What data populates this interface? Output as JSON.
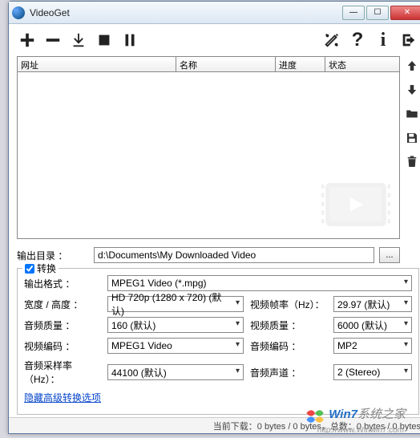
{
  "window": {
    "title": "VideoGet"
  },
  "winbtns": {
    "min": "—",
    "max": "☐",
    "close": "✕"
  },
  "grid": {
    "cols": {
      "url": "网址",
      "name": "名称",
      "progress": "进度",
      "status": "状态"
    }
  },
  "outdir": {
    "label": "输出目录 ：",
    "value": "d:\\Documents\\My Downloaded Video",
    "browse": "..."
  },
  "convert": {
    "legend": "转换",
    "format_label": "输出格式 ：",
    "format_value": "MPEG1 Video (*.mpg)",
    "size_label": "宽度 / 高度 ：",
    "size_value": "HD 720p (1280 x 720) (默认)",
    "fps_label": "视频帧率（Hz）：",
    "fps_value": "29.97 (默认)",
    "aq_label": "音频质量 ：",
    "aq_value": "160 (默认)",
    "vq_label": "视频质量 ：",
    "vq_value": "6000 (默认)",
    "vc_label": "视频编码 ：",
    "vc_value": "MPEG1 Video",
    "ac_label": "音频编码 ：",
    "ac_value": "MP2",
    "ar_label": "音频采样率（Hz）：",
    "ar_value": "44100 (默认)",
    "ch_label": "音频声道 ：",
    "ch_value": "2 (Stereo)",
    "advanced_link": "隐藏高级转换选项"
  },
  "statusbar": "当前下载：0 bytes / 0 bytes，总数：0 bytes / 0 bytes",
  "watermark": {
    "brand_a": "Win7",
    "brand_b": "系统之家",
    "url": "http://www.Winwin7.com"
  }
}
